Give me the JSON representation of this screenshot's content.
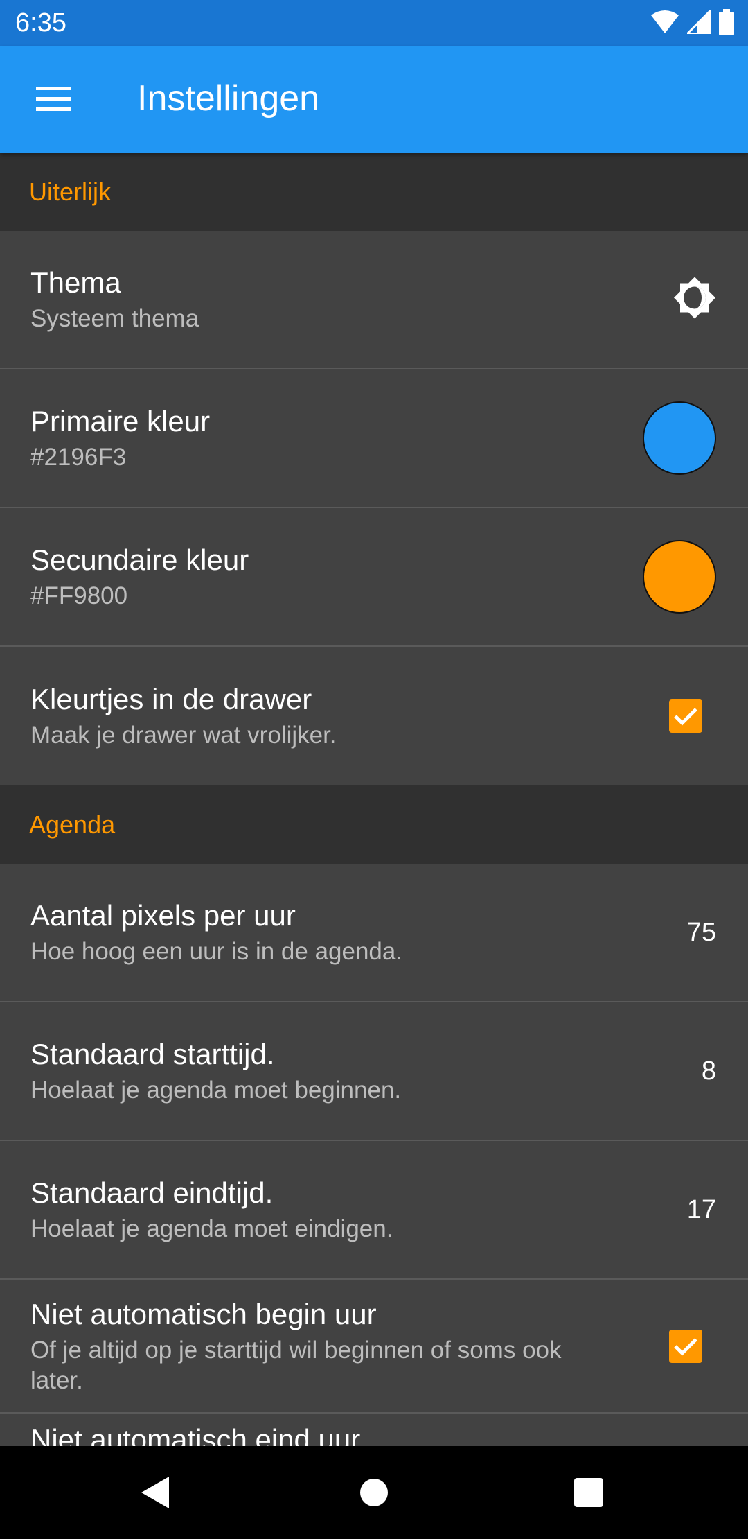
{
  "status": {
    "time": "6:35",
    "icons": [
      "wifi-icon",
      "cell-signal-icon",
      "battery-icon"
    ]
  },
  "toolbar": {
    "title": "Instellingen",
    "menu_icon": "menu-icon",
    "color": "#2196F3"
  },
  "sections": [
    {
      "header": "Uiterlijk",
      "items": [
        {
          "title": "Thema",
          "subtitle": "Systeem thema",
          "control": "theme-icon"
        },
        {
          "title": "Primaire kleur",
          "subtitle": "#2196F3",
          "control": "color-swatch",
          "color": "#2196F3"
        },
        {
          "title": "Secundaire kleur",
          "subtitle": "#FF9800",
          "control": "color-swatch",
          "color": "#FF9800"
        },
        {
          "title": "Kleurtjes in de drawer",
          "subtitle": "Maak je drawer wat vrolijker.",
          "control": "checkbox",
          "checked": true
        }
      ]
    },
    {
      "header": "Agenda",
      "items": [
        {
          "title": "Aantal pixels per uur",
          "subtitle": "Hoe hoog een uur is in de agenda.",
          "value": "75"
        },
        {
          "title": "Standaard starttijd.",
          "subtitle": "Hoelaat je agenda moet beginnen.",
          "value": "8"
        },
        {
          "title": "Standaard eindtijd.",
          "subtitle": "Hoelaat je agenda moet eindigen.",
          "value": "17"
        },
        {
          "title": "Niet automatisch begin uur",
          "subtitle": "Of je altijd op je starttijd wil beginnen of soms ook later.",
          "control": "checkbox",
          "checked": true
        },
        {
          "title": "Niet automatisch eind uur",
          "subtitle": ""
        }
      ]
    }
  ],
  "navigation": {
    "buttons": [
      "back-icon",
      "home-icon",
      "recents-icon"
    ]
  },
  "colors": {
    "accent": "#FF9800",
    "primary": "#2196F3",
    "status_bar": "#1976D2",
    "background": "#424242",
    "section_header_bg": "#303030"
  }
}
